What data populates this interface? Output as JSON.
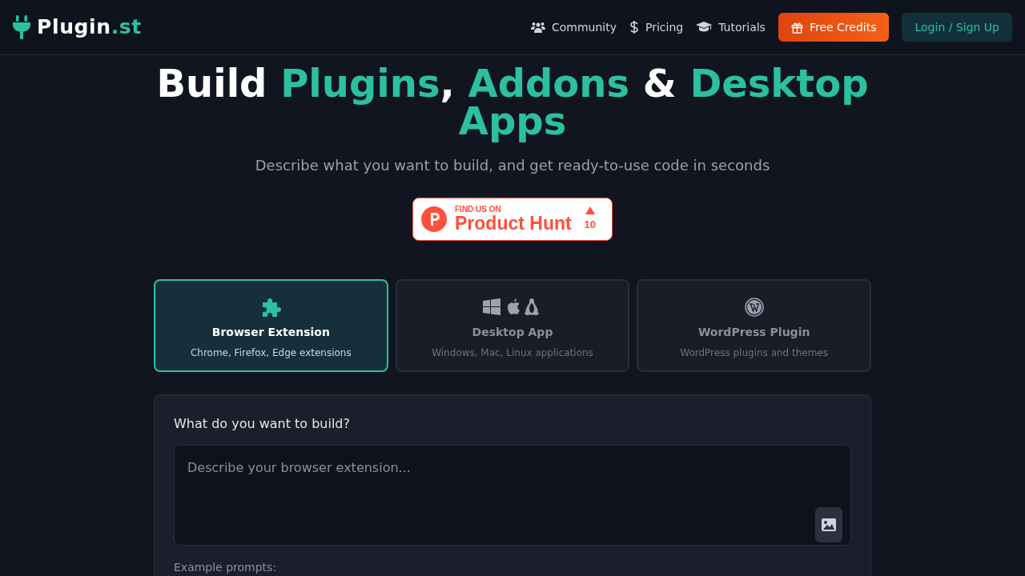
{
  "brand": {
    "name": "Plugin",
    "suffix": ".st"
  },
  "nav": [
    {
      "label": "Community"
    },
    {
      "label": "Pricing"
    },
    {
      "label": "Tutorials"
    }
  ],
  "buttons": [
    {
      "label": "Free Credits",
      "kind": "primary"
    },
    {
      "label": "Login / Sign Up",
      "kind": "secondary"
    }
  ],
  "headline": [
    {
      "text": "Build ",
      "accent": false
    },
    {
      "text": "Plugins",
      "accent": true
    },
    {
      "text": ", ",
      "accent": false
    },
    {
      "text": "Addons",
      "accent": true
    },
    {
      "text": " & ",
      "accent": false
    },
    {
      "text": "Desktop Apps",
      "accent": true
    }
  ],
  "subtitle": "Describe what you want to build, and get ready-to-use code in seconds",
  "badge": {
    "small": "FIND US ON",
    "big": "Product Hunt",
    "count": "10"
  },
  "types": [
    {
      "title": "Browser Extension",
      "desc": "Chrome, Firefox, Edge extensions",
      "kind": "browser",
      "selected": true
    },
    {
      "title": "Desktop App",
      "desc": "Windows, Mac, Linux applications",
      "kind": "desktop",
      "selected": false
    },
    {
      "title": "WordPress Plugin",
      "desc": "WordPress plugins and themes",
      "kind": "wordpress",
      "selected": false
    }
  ],
  "form": {
    "label": "What do you want to build?",
    "placeholder": "Describe your browser extension...",
    "examples_label": "Example prompts:"
  }
}
